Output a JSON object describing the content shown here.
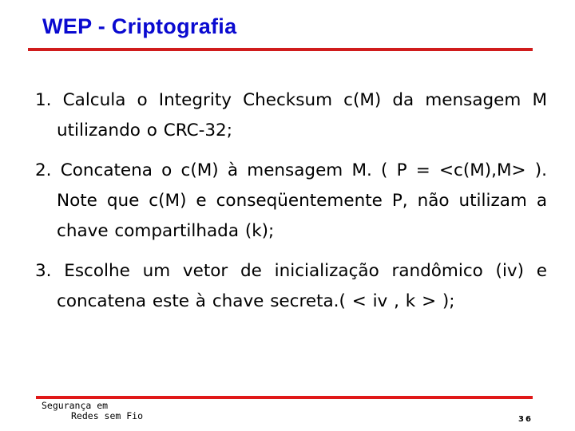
{
  "slide": {
    "title": "WEP - Criptografia",
    "colors": {
      "title": "#0a0ad0",
      "rule_top": "#d01c1c",
      "rule_bottom": "#e01818",
      "text": "#000000"
    },
    "items": [
      {
        "text": "1. Calcula o Integrity Checksum c(M) da mensagem M utilizando o CRC-32;"
      },
      {
        "text": "2. Concatena o c(M) à mensagem M. ( P = <c(M),M>   ). Note que c(M) e conseqüentemente P, não utilizam a chave compartilhada (k);"
      },
      {
        "text": "3.  Escolhe um vetor de inicialização randômico (iv) e concatena este à chave secreta.( < iv , k > );"
      }
    ]
  },
  "footer": {
    "course_line1": "Segurança em",
    "course_line2": "Redes sem Fio",
    "page_number": "36"
  }
}
